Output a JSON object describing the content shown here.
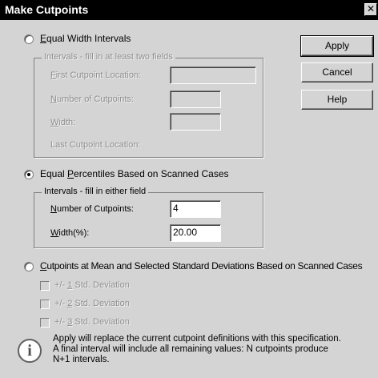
{
  "window": {
    "title": "Make Cutpoints",
    "close_glyph": "✕"
  },
  "option_equal_width": {
    "label": "Equal Width Intervals",
    "selected": false,
    "group_legend": "Intervals - fill in at least two fields",
    "fields": {
      "first_cutpoint_label": "First Cutpoint Location:",
      "first_cutpoint_value": "",
      "num_cutpoints_label": "Number of Cutpoints:",
      "num_cutpoints_value": "",
      "width_label": "Width:",
      "width_value": "",
      "last_cutpoint_label": "Last Cutpoint Location:"
    }
  },
  "option_equal_percentiles": {
    "label": "Equal Percentiles Based on Scanned Cases",
    "selected": true,
    "group_legend": "Intervals - fill in either field",
    "fields": {
      "num_cutpoints_label": "Number of Cutpoints:",
      "num_cutpoints_value": "4",
      "width_label": "Width(%):",
      "width_value": "20.00"
    }
  },
  "option_mean_sd": {
    "label": "Cutpoints at Mean and Selected Standard Deviations Based on Scanned Cases",
    "selected": false,
    "checkboxes": [
      {
        "label": "+/- 1 Std. Deviation",
        "checked": false
      },
      {
        "label": "+/- 2 Std. Deviation",
        "checked": false
      },
      {
        "label": "+/- 3 Std. Deviation",
        "checked": false
      }
    ]
  },
  "buttons": {
    "apply": "Apply",
    "cancel": "Cancel",
    "help": "Help"
  },
  "info": {
    "icon": "info-icon",
    "line1": "Apply will replace the current cutpoint definitions with this specification.",
    "line2": "A final interval will include all remaining values: N cutpoints produce",
    "line3": "N+1 intervals."
  },
  "colors": {
    "dialog_bg": "#d4d4d4",
    "titlebar_bg": "#000000",
    "disabled_text": "#8f8f8f"
  }
}
